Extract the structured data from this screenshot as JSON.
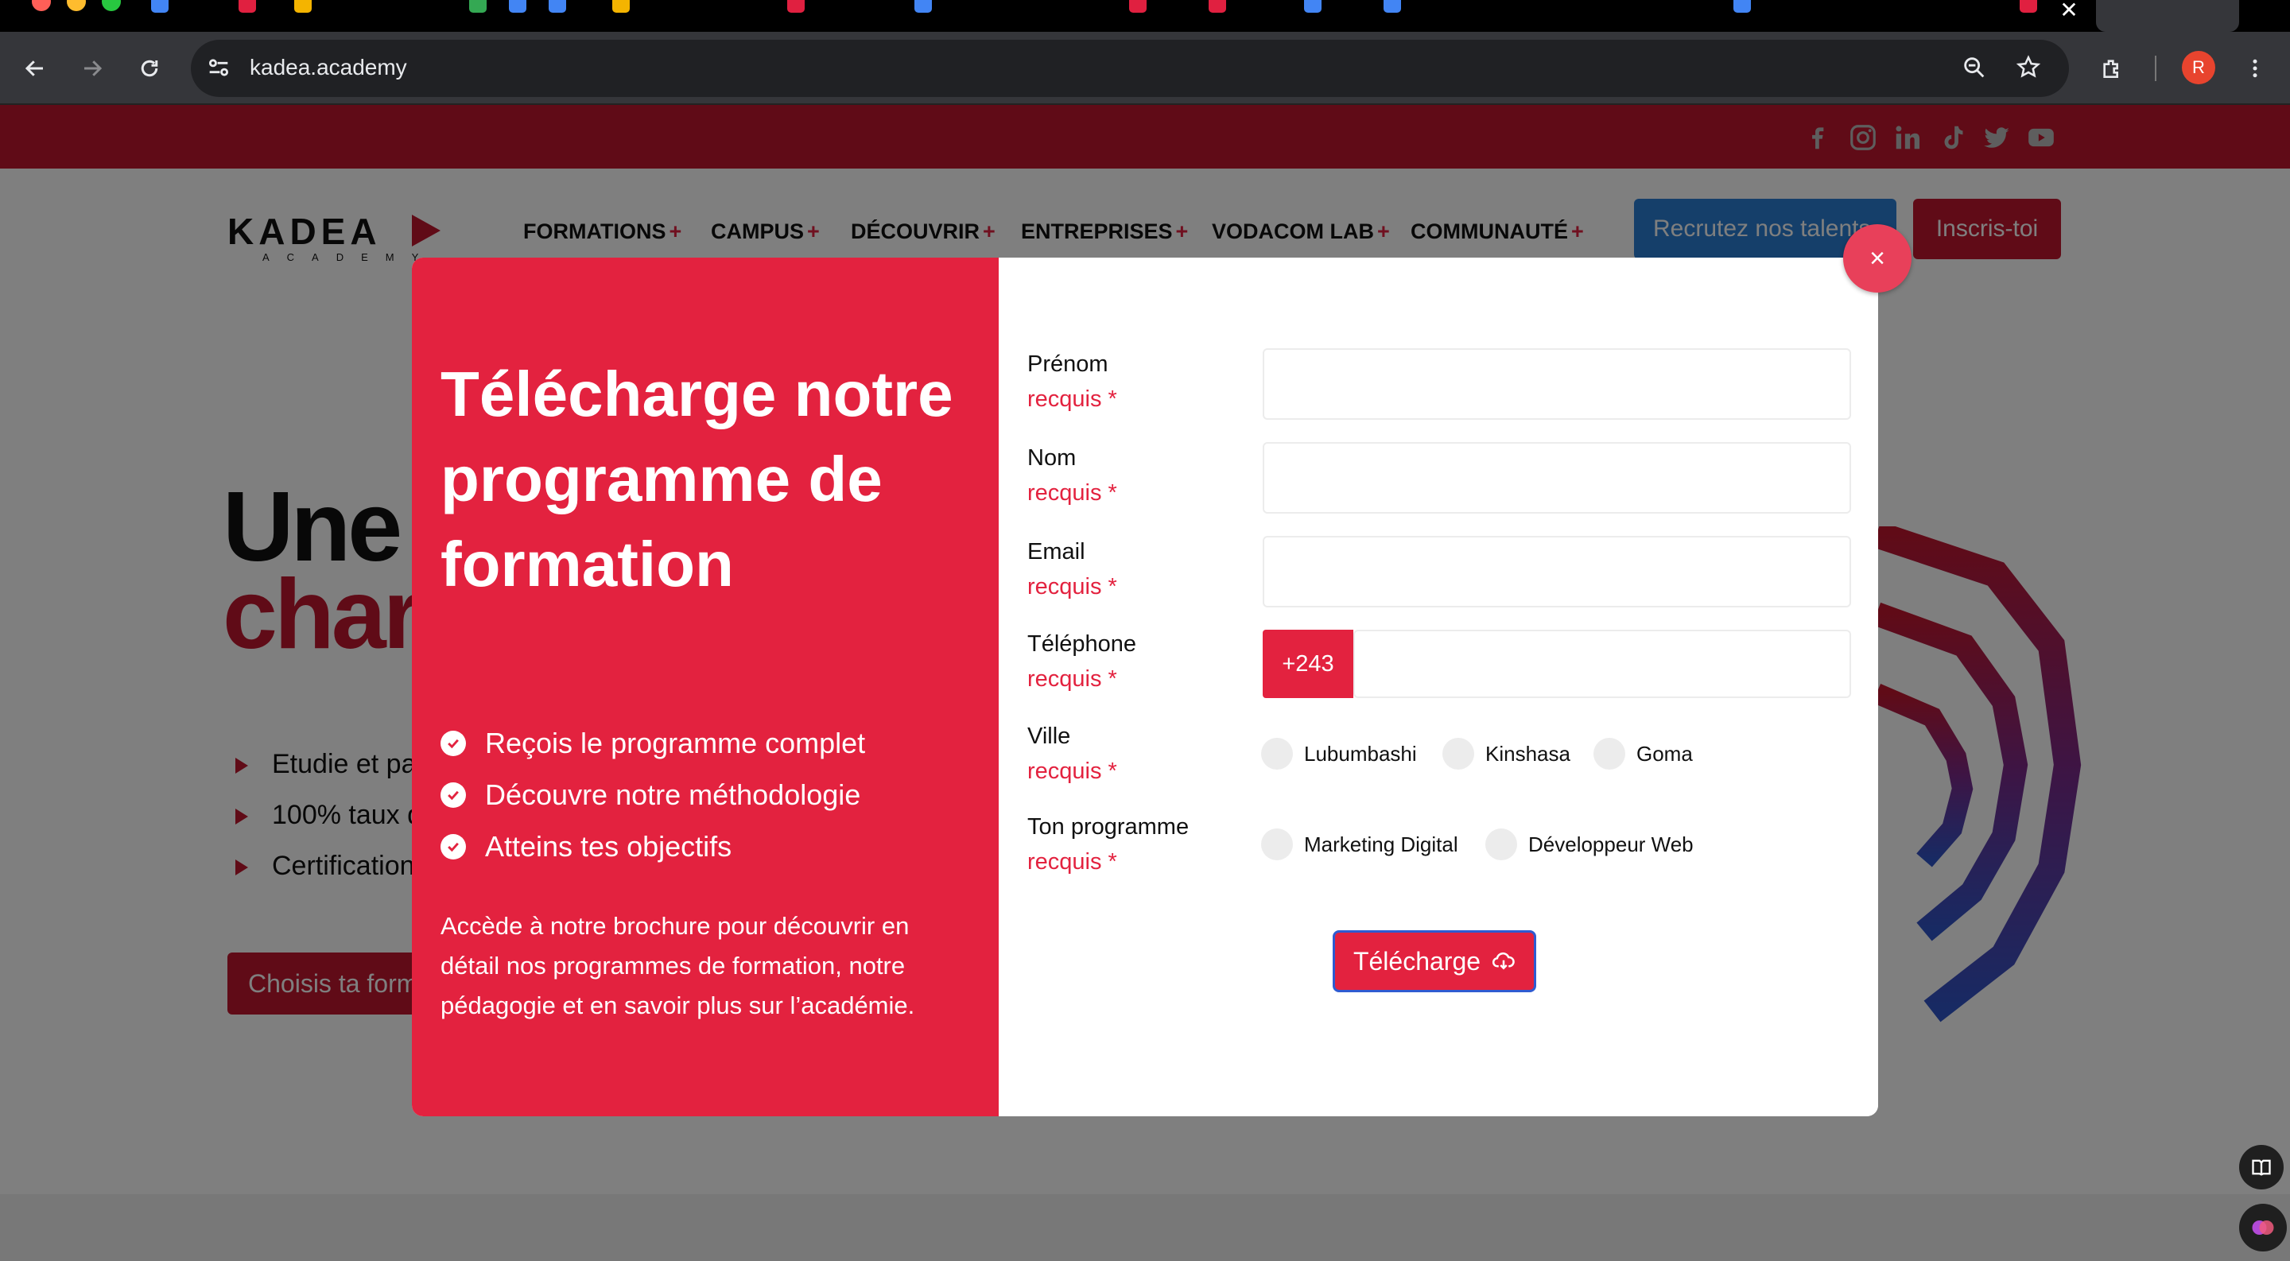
{
  "browser": {
    "url": "kadea.academy",
    "avatar_initial": "R"
  },
  "site": {
    "logo_text": "KADEA",
    "logo_sub": "ACADEMY",
    "nav": [
      {
        "label": "FORMATIONS"
      },
      {
        "label": "CAMPUS"
      },
      {
        "label": "DÉCOUVRIR"
      },
      {
        "label": "ENTREPRISES"
      },
      {
        "label": "VODACOM LAB"
      },
      {
        "label": "COMMUNAUTÉ"
      }
    ],
    "nav_plus": "+",
    "btn_recruit": "Recrutez nos talents",
    "btn_inscris": "Inscris-toi",
    "social_icons": [
      "facebook-icon",
      "instagram-icon",
      "linkedin-icon",
      "tiktok-icon",
      "twitter-icon",
      "youtube-icon"
    ],
    "hero": {
      "title_line1": "Une",
      "title_line2": "char",
      "bullets": [
        "Etudie et pa",
        "100% taux d",
        "Certification"
      ],
      "cta": "Choisis ta formation"
    }
  },
  "modal": {
    "title": "Télécharge notre programme de formation",
    "checks": [
      "Reçois le programme complet",
      "Découvre notre méthodologie",
      "Atteins tes objectifs"
    ],
    "description": "Accède à notre brochure pour découvrir en détail nos programmes de formation, notre pédagogie et en savoir plus sur l’académie.",
    "required_text": "recquis *",
    "fields": {
      "prenom": "Prénom",
      "nom": "Nom",
      "email": "Email",
      "telephone": "Téléphone",
      "ville": "Ville",
      "programme": "Ton programme"
    },
    "phone_prefix": "+243",
    "cities": [
      "Lubumbashi",
      "Kinshasa",
      "Goma"
    ],
    "programmes": [
      "Marketing Digital",
      "Développeur Web"
    ],
    "submit_label": "Télécharge",
    "close_symbol": "×"
  },
  "colors": {
    "brand_red": "#e3223f",
    "topbar_red": "#c0172f",
    "submit_border": "#2f5bd1"
  }
}
